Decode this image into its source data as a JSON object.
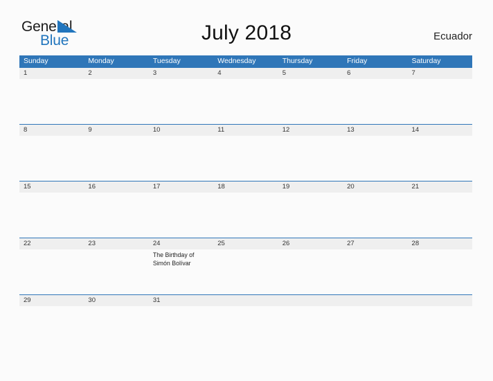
{
  "brand": {
    "name_part1": "General",
    "name_part2": "Blue",
    "flag_icon": "flag-triangle-icon",
    "accent_color": "#2175bd"
  },
  "header": {
    "title": "July 2018",
    "country": "Ecuador"
  },
  "theme": {
    "header_blue": "#2f76b8",
    "day_strip_gray": "#efefef",
    "page_background": "#fbfbfb",
    "text_dark": "#1a1a1a"
  },
  "calendar": {
    "month": "July",
    "year": "2018",
    "weekday_headers": [
      "Sunday",
      "Monday",
      "Tuesday",
      "Wednesday",
      "Thursday",
      "Friday",
      "Saturday"
    ],
    "weeks": [
      {
        "days": [
          {
            "number": "1",
            "event": ""
          },
          {
            "number": "2",
            "event": ""
          },
          {
            "number": "3",
            "event": ""
          },
          {
            "number": "4",
            "event": ""
          },
          {
            "number": "5",
            "event": ""
          },
          {
            "number": "6",
            "event": ""
          },
          {
            "number": "7",
            "event": ""
          }
        ]
      },
      {
        "days": [
          {
            "number": "8",
            "event": ""
          },
          {
            "number": "9",
            "event": ""
          },
          {
            "number": "10",
            "event": ""
          },
          {
            "number": "11",
            "event": ""
          },
          {
            "number": "12",
            "event": ""
          },
          {
            "number": "13",
            "event": ""
          },
          {
            "number": "14",
            "event": ""
          }
        ]
      },
      {
        "days": [
          {
            "number": "15",
            "event": ""
          },
          {
            "number": "16",
            "event": ""
          },
          {
            "number": "17",
            "event": ""
          },
          {
            "number": "18",
            "event": ""
          },
          {
            "number": "19",
            "event": ""
          },
          {
            "number": "20",
            "event": ""
          },
          {
            "number": "21",
            "event": ""
          }
        ]
      },
      {
        "days": [
          {
            "number": "22",
            "event": ""
          },
          {
            "number": "23",
            "event": ""
          },
          {
            "number": "24",
            "event": "The Birthday of Simón Bolívar"
          },
          {
            "number": "25",
            "event": ""
          },
          {
            "number": "26",
            "event": ""
          },
          {
            "number": "27",
            "event": ""
          },
          {
            "number": "28",
            "event": ""
          }
        ]
      },
      {
        "days": [
          {
            "number": "29",
            "event": ""
          },
          {
            "number": "30",
            "event": ""
          },
          {
            "number": "31",
            "event": ""
          },
          {
            "number": "",
            "event": ""
          },
          {
            "number": "",
            "event": ""
          },
          {
            "number": "",
            "event": ""
          },
          {
            "number": "",
            "event": ""
          }
        ]
      }
    ]
  }
}
